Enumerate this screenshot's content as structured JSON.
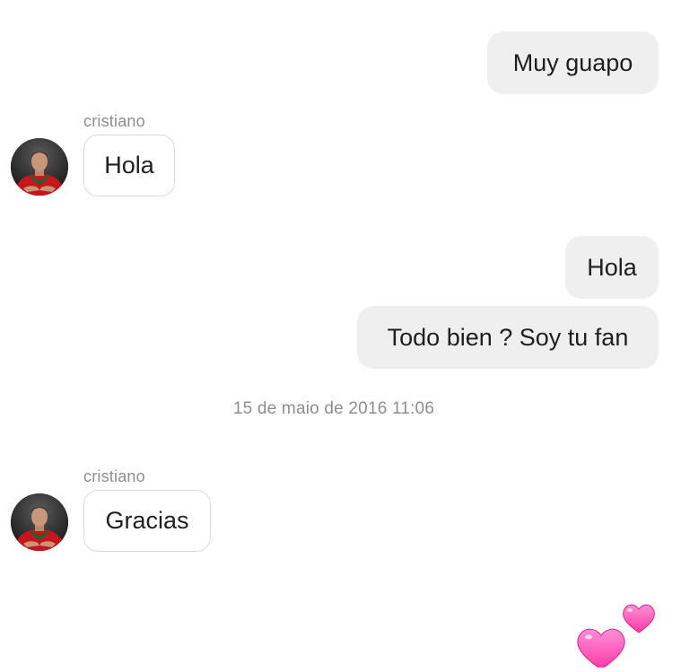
{
  "messages": {
    "m1": {
      "text": "Muy guapo"
    },
    "m2_sender": "cristiano",
    "m2": {
      "text": "Hola"
    },
    "m3": {
      "text": "Hola"
    },
    "m4": {
      "text": "Todo bien ? Soy tu fan"
    },
    "timestamp": "15 de maio de 2016 11:06",
    "m5_sender": "cristiano",
    "m5": {
      "text": "Gracias"
    }
  },
  "icons": {
    "avatar": "profile-photo-avatar",
    "reaction": "two-pink-hearts-icon"
  },
  "colors": {
    "outgoing_bubble": "#efefef",
    "incoming_border": "#dbdbdb",
    "meta_text": "#8e8e8e",
    "heart": "#ff4fb8"
  }
}
